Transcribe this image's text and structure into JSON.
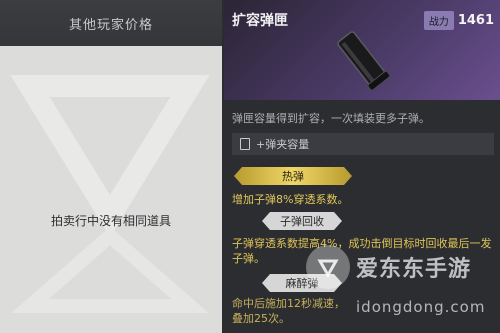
{
  "left": {
    "header": "其他玩家价格",
    "empty_text": "拍卖行中没有相同道具"
  },
  "item": {
    "name": "扩容弹匣",
    "power_label": "战力",
    "power_value": "1461",
    "description": "弹匣容量得到扩容，一次填装更多子弹。",
    "capacity": "+弹夹容量"
  },
  "perks": [
    {
      "label": "热弹",
      "effect": "增加子弹8%穿透系数。"
    },
    {
      "label": "子弹回收",
      "effect": "子弹穿透系数提高4%，成功击倒目标时回收最后一发子弹。"
    },
    {
      "label": "麻醉弹",
      "effect": "命中后施加12秒减速，叠加25次。"
    }
  ],
  "watermark": {
    "name": "爱东东手游",
    "url": "idongdong.com"
  },
  "colors": {
    "gold": "#e4c85a",
    "accent_purple": "#6a4f8e"
  }
}
